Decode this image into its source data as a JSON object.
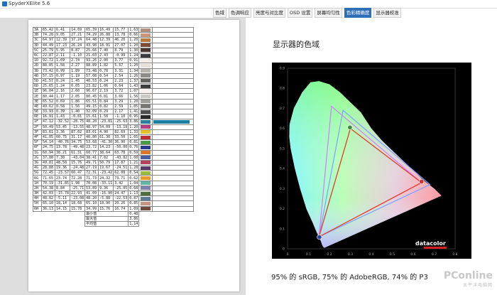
{
  "window": {
    "title": "SpyderXElite 5.6"
  },
  "tabs": [
    {
      "label": "色域",
      "active": false
    },
    {
      "label": "色调响应",
      "active": false
    },
    {
      "label": "亮度与对比度",
      "active": false
    },
    {
      "label": "OSD 设置",
      "active": false
    },
    {
      "label": "屏幕均匀性",
      "active": false
    },
    {
      "label": "色彩精确度",
      "active": true
    },
    {
      "label": "显示器校准",
      "active": false
    }
  ],
  "section_heading": "显示器的色域",
  "caption": "95% 的 sRGB, 75% 的 AdobeRGB, 74% 的 P3",
  "watermark": {
    "text": "PConline",
    "sub": "太平洋电脑网"
  },
  "chart_brand": "datacolor",
  "table_rows": [
    {
      "id": "3A",
      "v": [
        "65.42",
        "6.41",
        "14.69",
        "65.39",
        "16.49",
        "15.77"
      ],
      "de": "1.63",
      "c": "#b08f7e"
    },
    {
      "id": "3B",
      "v": [
        "74.28",
        "9.05",
        "27.21",
        "74.29",
        "26.88",
        "13.78"
      ],
      "de": "0.66",
      "c": "#c9977a"
    },
    {
      "id": "3C",
      "v": [
        "64.97",
        "12.39",
        "37.24",
        "64.48",
        "12.39",
        "46.20"
      ],
      "de": "1.20",
      "c": "#b47a3f"
    },
    {
      "id": "3D",
      "v": [
        "44.49",
        "17.23",
        "26.24",
        "43.98",
        "18.91",
        "27.07"
      ],
      "de": "1.20",
      "c": "#7d4a33"
    },
    {
      "id": "5C",
      "v": [
        "25.79",
        "5.95",
        "8.87",
        "25.66",
        "7.40",
        "8.79"
      ],
      "de": "1.30",
      "c": "#4a3830"
    },
    {
      "id": "6C",
      "v": [
        "22.87",
        "2.11",
        "-1.10",
        "21.03",
        "2.43",
        "-0.99"
      ],
      "de": "1.24",
      "c": "#3b3a3d"
    },
    {
      "id": "1D",
      "v": [
        "92.72",
        "1.69",
        "2.74",
        "93.26",
        "2.00",
        "3.77"
      ],
      "de": "0.91",
      "c": "#f3eeea"
    },
    {
      "id": "2D",
      "v": [
        "88.85",
        "1.58",
        "2.27",
        "88.89",
        "1.82",
        "5.57"
      ],
      "de": "1.20",
      "c": "#e4dfd8"
    },
    {
      "id": "3D",
      "v": [
        "73.42",
        "0.99",
        "1.89",
        "73.48",
        "0.78",
        "3.31"
      ],
      "de": "1.34",
      "c": "#b8b5b0"
    },
    {
      "id": "4D",
      "v": [
        "57.15",
        "0.97",
        "1.19",
        "57.08",
        "0.54",
        "2.54"
      ],
      "de": "1.26",
      "c": "#8e8c89"
    },
    {
      "id": "5D",
      "v": [
        "41.57",
        "0.24",
        "1.45",
        "40.53",
        "0.24",
        "2.23"
      ],
      "de": "1.37",
      "c": "#65635f"
    },
    {
      "id": "6D",
      "v": [
        "25.65",
        "1.24",
        "0.05",
        "23.82",
        "1.06",
        "0.64"
      ],
      "de": "1.43",
      "c": "#3f3e3e"
    },
    {
      "id": "1E",
      "v": [
        "96.04",
        "2.16",
        "2.60",
        "96.67",
        "2.19",
        "3.72"
      ],
      "de": "1.07",
      "c": "#fbf3ef"
    },
    {
      "id": "2E",
      "v": [
        "80.44",
        "1.17",
        "2.05",
        "80.45",
        "0.81",
        "3.66"
      ],
      "de": "1.56",
      "c": "#cdc9c4"
    },
    {
      "id": "3E",
      "v": [
        "65.52",
        "0.69",
        "1.86",
        "65.51",
        "0.84",
        "3.29"
      ],
      "de": "1.20",
      "c": "#a19f9b"
    },
    {
      "id": "4E",
      "v": [
        "49.62",
        "0.58",
        "1.56",
        "49.15",
        "0.82",
        "2.59"
      ],
      "de": "1.05",
      "c": "#787673"
    },
    {
      "id": "5E",
      "v": [
        "33.93",
        "0.39",
        "1.40",
        "32.09",
        "0.29",
        "2.17"
      ],
      "de": "1.41",
      "c": "#504f4d"
    },
    {
      "id": "6E",
      "v": [
        "16.91",
        "1.43",
        "-0.81",
        "15.61",
        "1.58",
        "-1.10"
      ],
      "de": "0.95",
      "c": "#2a2a2c"
    },
    {
      "id": "1F",
      "v": [
        "47.12",
        "-32.52",
        "-28.75",
        "48.20",
        "-23.81",
        "-25.63"
      ],
      "de": "3.86",
      "c": "#2e7f9c",
      "bar": 0.92
    },
    {
      "id": "2F",
      "v": [
        "50.49",
        "53.45",
        "-13.55",
        "48.97",
        "54.09",
        "-13.19"
      ],
      "de": "1.20",
      "c": "#b63d7f"
    },
    {
      "id": "3F",
      "v": [
        "83.61",
        "3.36",
        "87.02",
        "83.01",
        "4.90",
        "82.69"
      ],
      "de": "1.33",
      "c": "#e0c12a"
    },
    {
      "id": "4F",
      "v": [
        "41.05",
        "60.75",
        "31.17",
        "40.80",
        "61.30",
        "33.50"
      ],
      "de": "1.05",
      "c": "#b92f35"
    },
    {
      "id": "5F",
      "v": [
        "54.14",
        "-40.76",
        "34.75",
        "53.68",
        "-41.30",
        "36.90"
      ],
      "de": "0.81",
      "c": "#4a9a4c"
    },
    {
      "id": "6F",
      "v": [
        "24.75",
        "13.78",
        "-49.48",
        "23.72",
        "14.23",
        "-50.00"
      ],
      "de": "0.76",
      "c": "#2d3a8f"
    },
    {
      "id": "1G",
      "v": [
        "60.94",
        "38.21",
        "61.31",
        "60.77",
        "38.64",
        "63.78"
      ],
      "de": "0.59",
      "c": "#d47a2a"
    },
    {
      "id": "2G",
      "v": [
        "37.80",
        "7.30",
        "-43.04",
        "38.41",
        "7.02",
        "-43.82"
      ],
      "de": "1.08",
      "c": "#4a5da0"
    },
    {
      "id": "3G",
      "v": [
        "49.81",
        "48.50",
        "15.76",
        "49.71",
        "50.79",
        "17.87"
      ],
      "de": "1.21",
      "c": "#b6415e"
    },
    {
      "id": "4G",
      "v": [
        "28.88",
        "19.36",
        "-24.48",
        "27.19",
        "19.67",
        "-24.51"
      ],
      "de": "1.28",
      "c": "#5a3a6d"
    },
    {
      "id": "5G",
      "v": [
        "72.45",
        "-23.57",
        "60.47",
        "72.31",
        "-23.42",
        "62.08"
      ],
      "de": "0.54",
      "c": "#99bb3f"
    },
    {
      "id": "6G",
      "v": [
        "71.65",
        "23.74",
        "72.28",
        "71.73",
        "24.32",
        "73.71"
      ],
      "de": "0.62",
      "c": "#e39a2c"
    },
    {
      "id": "1H",
      "v": [
        "70.19",
        "-31.85",
        "1.98",
        "70.08",
        "-33.11",
        "3.42"
      ],
      "de": "1.04",
      "c": "#63b59f"
    },
    {
      "id": "2H",
      "v": [
        "54.38",
        "8.84",
        "-25.71",
        "53.89",
        "9.36",
        "-25.05"
      ],
      "de": "0.68",
      "c": "#7d80b0"
    },
    {
      "id": "3H",
      "v": [
        "42.03",
        "-15.78",
        "22.93",
        "41.09",
        "-16.90",
        "24.47"
      ],
      "de": "1.13",
      "c": "#4d6f3a"
    },
    {
      "id": "4H",
      "v": [
        "48.82",
        "-5.11",
        "-23.08",
        "48.20",
        "-5.88",
        "-22.53"
      ],
      "de": "0.87",
      "c": "#5b7994"
    },
    {
      "id": "5H",
      "v": [
        "65.10",
        "18.14",
        "18.68",
        "65.10",
        "18.90",
        "20.26"
      ],
      "de": "0.85",
      "c": "#c49480"
    },
    {
      "id": "6H",
      "v": [
        "36.13",
        "14.15",
        "15.78",
        "34.99",
        "15.76",
        "16.74"
      ],
      "de": "1.09",
      "c": "#6e4b3c"
    }
  ],
  "summary": [
    {
      "label": "最小值",
      "value": "0.48"
    },
    {
      "label": "最大值",
      "value": "3.86"
    },
    {
      "label": "平均值",
      "value": "1.14"
    }
  ],
  "chart_data": {
    "type": "scatter",
    "description_of_plot": "CIE 1931 xy chromaticity gamut chart",
    "x_ticks": [
      "0",
      "0.1",
      "0.2",
      "0.3",
      "0.4",
      "0.5",
      "0.6",
      "0.7",
      "0.8"
    ],
    "y_ticks": [
      "0",
      "0.1",
      "0.2",
      "0.3",
      "0.4",
      "0.5",
      "0.6",
      "0.7",
      "0.8",
      "0.9"
    ],
    "xlim": [
      0,
      0.8
    ],
    "ylim": [
      0,
      0.9
    ],
    "series": [
      {
        "color": "#ff3030",
        "points": [
          [
            0.64,
            0.33
          ],
          [
            0.3,
            0.6
          ],
          [
            0.15,
            0.06
          ]
        ]
      },
      {
        "color": "#20d020",
        "points": [
          [
            0.64,
            0.33
          ],
          [
            0.3,
            0.6
          ],
          [
            0.15,
            0.06
          ]
        ]
      },
      {
        "color": "#d07cff",
        "points": [
          [
            0.64,
            0.33
          ],
          [
            0.21,
            0.71
          ],
          [
            0.15,
            0.06
          ]
        ]
      },
      {
        "color": "#7fa0ff",
        "points": [
          [
            0.68,
            0.32
          ],
          [
            0.265,
            0.69
          ],
          [
            0.15,
            0.06
          ]
        ]
      }
    ],
    "primaries_measured": [
      [
        0.64,
        0.335
      ],
      [
        0.298,
        0.605
      ],
      [
        0.152,
        0.058
      ]
    ]
  }
}
